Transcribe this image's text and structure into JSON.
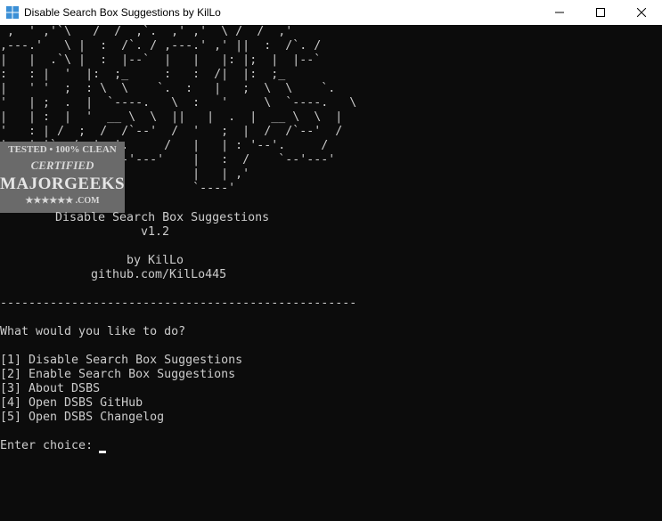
{
  "window": {
    "title": "Disable Search Box Suggestions by KilLo",
    "controls": {
      "minimize_icon": "minimize-icon",
      "maximize_icon": "maximize-icon",
      "close_icon": "close-icon"
    }
  },
  "console": {
    "ascii_banner": " ,  ' ,'`\\   /  /  ,`.  ,' ,'  \\ /  /  ,'\n,---.'   \\ |  :  /`. / ,---.' ,' ||  :  /`. /\n|   |  .`\\ |  :  |--`  |   |   |: |;  |  |--`\n:   : |  '  |:  ;_     :   :  /|  |:  ;_\n|   ' '  ;  : \\  \\    `.  :   |   ;  \\  \\    `.\n'   | ;  .  |  `----.   \\  :   '     \\  `----.   \\\n|   | :  |  '  __ \\  \\  ||   |  .  |  __ \\  \\  |\n'   : | /  ;  /  /`--'  /  '   ;  |  /  /`--'  /\n|   | '` ,/  '--'.     /   |   | : '--'.     /\n;   :  .'      `--'---'    |   :  /    `--'---'\n|   ,.'                    |   | ,'\n'---'                      `----'",
    "app_name": "Disable Search Box Suggestions",
    "version": "v1.2",
    "author": "by KilLo",
    "github": "github.com/KilLo445",
    "separator": "--------------------------------------------------",
    "prompt_question": "What would you like to do?",
    "menu": [
      "[1] Disable Search Box Suggestions",
      "[2] Enable Search Box Suggestions",
      "[3] About DSBS",
      "[4] Open DSBS GitHub",
      "[5] Open DSBS Changelog"
    ],
    "input_prompt": "Enter choice: "
  },
  "badge": {
    "top": "TESTED • 100% CLEAN",
    "certified": "CERTIFIED",
    "name": "MAJORGEEKS",
    "bottom": "★★★★★★ .COM"
  },
  "colors": {
    "console_bg": "#0c0c0c",
    "console_text": "#cccccc",
    "titlebar_bg": "#ffffff"
  }
}
